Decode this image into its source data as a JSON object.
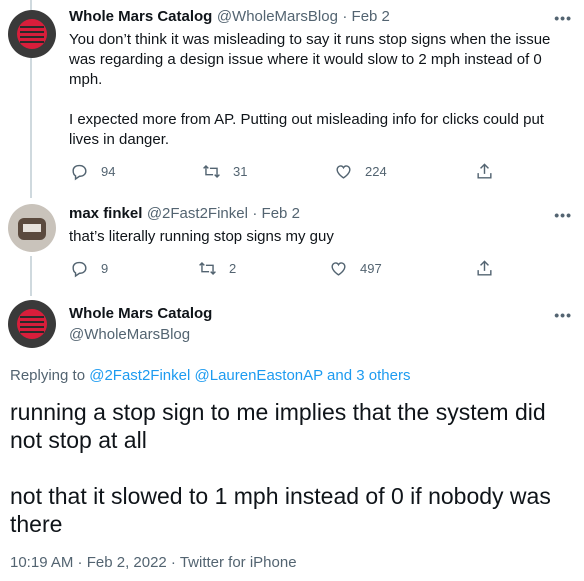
{
  "tweet1": {
    "name": "Whole Mars Catalog",
    "handle": "@WholeMarsBlog",
    "date": "· Feb 2",
    "line1": "You don’t think it was misleading to say it runs stop signs when the issue",
    "line2": "was regarding a design issue where it would slow to 2 mph instead of 0",
    "line3": "mph.",
    "line4": "I expected more from AP. Putting out misleading info for clicks could put",
    "line5": "lives in danger.",
    "replies": "94",
    "retweets": "31",
    "likes": "224"
  },
  "tweet2": {
    "name": "max finkel",
    "handle": "@2Fast2Finkel",
    "date": "· Feb 2",
    "text": "that’s literally running stop signs my guy",
    "replies": "9",
    "retweets": "2",
    "likes": "497"
  },
  "main": {
    "name": "Whole Mars Catalog",
    "handle": "@WholeMarsBlog",
    "replying_prefix": "Replying to ",
    "replying_user1": "@2Fast2Finkel",
    "replying_user2": "@LaurenEastonAP",
    "replying_others": "and 3 others",
    "para1_line1": "running a stop sign to me implies that the system did",
    "para1_line2": "not stop at all",
    "para2_line1": "not that it slowed to 1 mph instead of 0 if nobody was",
    "para2_line2": "there",
    "meta": "10:19 AM · Feb 2, 2022 · Twitter for iPhone"
  },
  "more_label": "•••",
  "icons": [
    "reply-icon",
    "retweet-icon",
    "like-icon",
    "share-icon",
    "more-icon"
  ],
  "colors": {
    "link": "#1d9bf0",
    "muted": "#536471",
    "text": "#0f1419",
    "avatar_red": "#d81e3b"
  }
}
